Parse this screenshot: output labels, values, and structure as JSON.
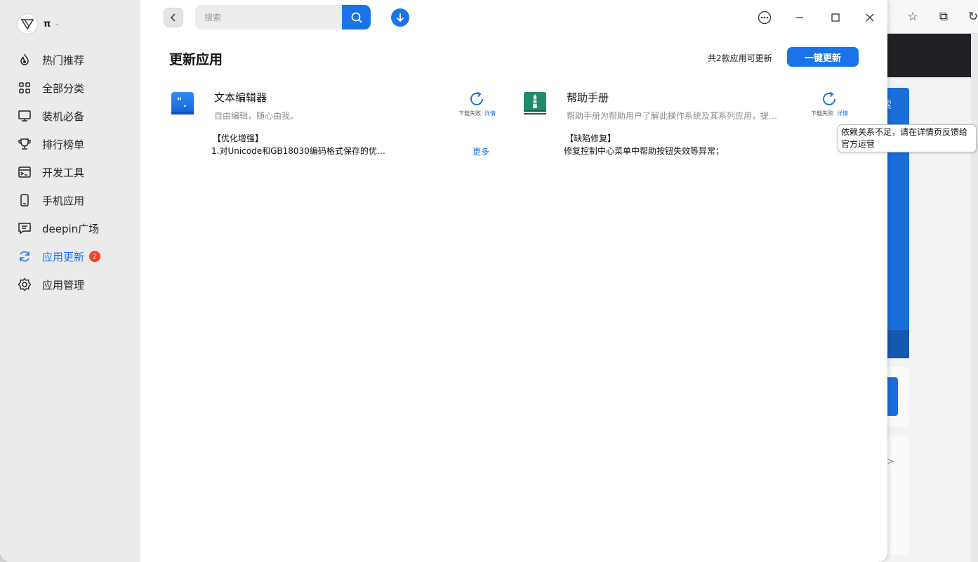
{
  "sidebar": {
    "brand_name": "π",
    "items": [
      {
        "label": "热门推荐",
        "icon": "flame-icon"
      },
      {
        "label": "全部分类",
        "icon": "grid-icon"
      },
      {
        "label": "装机必备",
        "icon": "monitor-icon"
      },
      {
        "label": "排行榜单",
        "icon": "trophy-icon"
      },
      {
        "label": "开发工具",
        "icon": "terminal-icon"
      },
      {
        "label": "手机应用",
        "icon": "phone-icon"
      },
      {
        "label": "deepin广场",
        "icon": "chat-icon"
      },
      {
        "label": "应用更新",
        "icon": "refresh-icon",
        "badge": "2",
        "active": true
      },
      {
        "label": "应用管理",
        "icon": "gear-icon"
      }
    ]
  },
  "toolbar": {
    "search_placeholder": "搜索"
  },
  "main": {
    "title": "更新应用",
    "count_text": "共2款应用可更新",
    "update_all_label": "一键更新",
    "apps": [
      {
        "name": "文本编辑器",
        "description": "自由编辑，随心由我。",
        "status": "下载失败",
        "detail_label": "详情",
        "log_title": "【优化增强】",
        "log_line": "1.对Unicode和GB18030编码格式保存的优化…",
        "more_label": "更多"
      },
      {
        "name": "帮助手册",
        "description": "帮助手册为帮助用户了解此操作系统及其系列应用，提…",
        "status": "下载失败",
        "detail_label": "详情",
        "log_title": "【缺陷修复】",
        "log_line": "修复控制中心菜单中帮助按钮失效等异常；"
      }
    ],
    "tooltip": "依赖关系不足，请在详情页反馈给官方运营"
  },
  "background_window": {
    "search_fragment": "索",
    "link_fragment": "多>"
  },
  "colors": {
    "accent": "#1a73e8",
    "sidebar_bg": "#ebebeb",
    "badge": "#ff3b30"
  }
}
